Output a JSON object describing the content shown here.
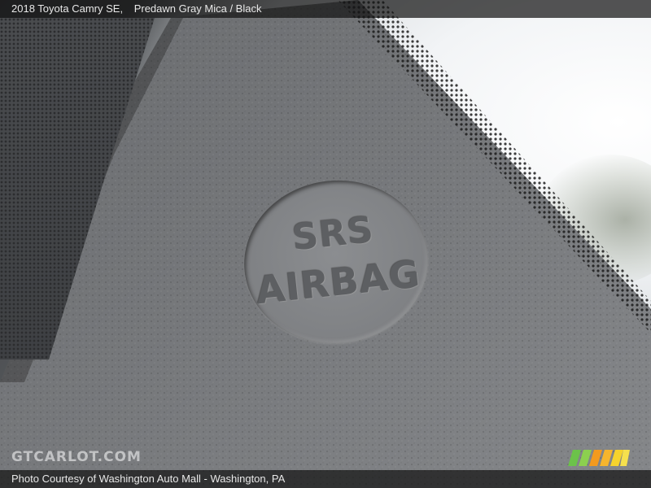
{
  "header": {
    "vehicle": "2018 Toyota Camry SE,",
    "color": "Predawn Gray Mica / Black"
  },
  "badge": {
    "line1": "SRS",
    "line2": "AIRBAG"
  },
  "footer": {
    "credit": "Photo Courtesy of Washington Auto Mall - Washington, PA"
  },
  "watermark": {
    "text": "GTCARLOT.COM"
  },
  "colors": {
    "stripe_green": "#6cc24a",
    "stripe_orange": "#f39a1e",
    "stripe_yellow": "#f6d32d"
  }
}
